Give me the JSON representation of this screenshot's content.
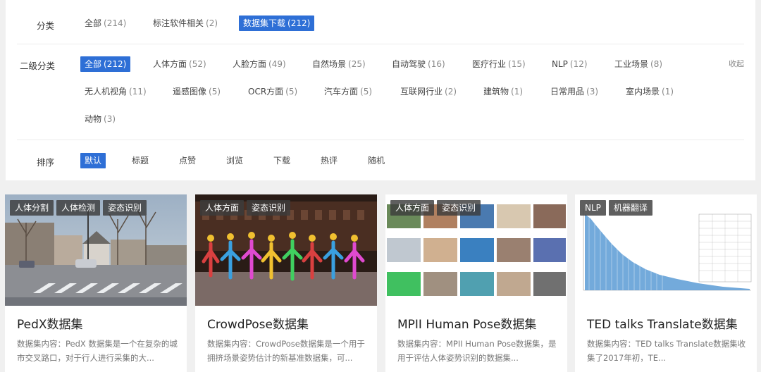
{
  "filters": {
    "category": {
      "label": "分类",
      "options": [
        {
          "name": "全部",
          "count": "(214)"
        },
        {
          "name": "标注软件相关",
          "count": "(2)"
        },
        {
          "name": "数据集下载",
          "count": "(212)"
        }
      ]
    },
    "subcategory": {
      "label": "二级分类",
      "collapse_label": "收起",
      "options": [
        {
          "name": "全部",
          "count": "(212)"
        },
        {
          "name": "人体方面",
          "count": "(52)"
        },
        {
          "name": "人脸方面",
          "count": "(49)"
        },
        {
          "name": "自然场景",
          "count": "(25)"
        },
        {
          "name": "自动驾驶",
          "count": "(16)"
        },
        {
          "name": "医疗行业",
          "count": "(15)"
        },
        {
          "name": "NLP",
          "count": "(12)"
        },
        {
          "name": "工业场景",
          "count": "(8)"
        },
        {
          "name": "无人机视角",
          "count": "(11)"
        },
        {
          "name": "遥感图像",
          "count": "(5)"
        },
        {
          "name": "OCR方面",
          "count": "(5)"
        },
        {
          "name": "汽车方面",
          "count": "(5)"
        },
        {
          "name": "互联网行业",
          "count": "(2)"
        },
        {
          "name": "建筑物",
          "count": "(1)"
        },
        {
          "name": "日常用品",
          "count": "(3)"
        },
        {
          "name": "室内场景",
          "count": "(1)"
        },
        {
          "name": "动物",
          "count": "(3)"
        }
      ]
    },
    "sort": {
      "label": "排序",
      "options": [
        "默认",
        "标题",
        "点赞",
        "浏览",
        "下载",
        "热评",
        "随机"
      ]
    }
  },
  "cards": [
    {
      "tags": [
        "人体分割",
        "人体检测",
        "姿态识别"
      ],
      "title": "PedX数据集",
      "desc": "数据集内容：PedX 数据集是一个在复杂的城市交叉路口，对于行人进行采集的大..."
    },
    {
      "tags": [
        "人体方面",
        "姿态识别"
      ],
      "title": "CrowdPose数据集",
      "desc": "数据集内容：CrowdPose数据集是一个用于拥挤场景姿势估计的新基准数据集，可..."
    },
    {
      "tags": [
        "人体方面",
        "姿态识别"
      ],
      "title": "MPII Human Pose数据集",
      "desc": "数据集内容：MPII Human Pose数据集，是用于评估人体姿势识别的数据集..."
    },
    {
      "tags": [
        "NLP",
        "机器翻译"
      ],
      "title": "TED talks Translate数据集",
      "desc": "数据集内容：TED talks Translate数据集收集了2017年初，TE..."
    }
  ]
}
